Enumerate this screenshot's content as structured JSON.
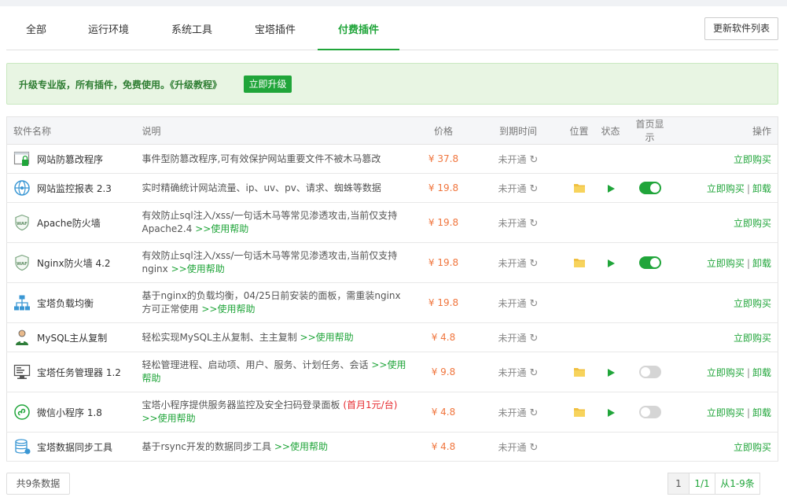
{
  "tabs": [
    "全部",
    "运行环境",
    "系统工具",
    "宝塔插件",
    "付费插件"
  ],
  "active_tab": "付费插件",
  "refresh_button": "更新软件列表",
  "upgrade": {
    "text": "升级专业版，所有插件，免费使用。《升级教程》",
    "button": "立即升级"
  },
  "columns": {
    "name": "软件名称",
    "desc": "说明",
    "price": "价格",
    "expire": "到期时间",
    "position": "位置",
    "state": "状态",
    "home": "首页显示",
    "op": "操作"
  },
  "rows": [
    {
      "name": "网站防篡改程序",
      "icon": "window-lock-icon",
      "desc": "事件型防篡改程序,可有效保护网站重要文件不被木马篡改",
      "help": "",
      "promo": "",
      "price": "¥ 37.8",
      "expire": "未开通",
      "installed": false,
      "toggle": null,
      "buy": "立即购买",
      "uninstall": ""
    },
    {
      "name": "网站监控报表 2.3",
      "icon": "globe-icon",
      "desc": "实时精确统计网站流量、ip、uv、pv、请求、蜘蛛等数据",
      "help": "",
      "promo": "",
      "price": "¥ 19.8",
      "expire": "未开通",
      "installed": true,
      "toggle": true,
      "buy": "立即购买",
      "uninstall": "卸载"
    },
    {
      "name": "Apache防火墙",
      "icon": "waf-shield-icon",
      "desc": "有效防止sql注入/xss/一句话木马等常见渗透攻击,当前仅支持Apache2.4",
      "help": ">>使用帮助",
      "promo": "",
      "price": "¥ 19.8",
      "expire": "未开通",
      "installed": false,
      "toggle": null,
      "buy": "立即购买",
      "uninstall": ""
    },
    {
      "name": "Nginx防火墙 4.2",
      "icon": "waf-shield-icon",
      "desc": "有效防止sql注入/xss/一句话木马等常见渗透攻击,当前仅支持nginx",
      "help": ">>使用帮助",
      "promo": "",
      "price": "¥ 19.8",
      "expire": "未开通",
      "installed": true,
      "toggle": true,
      "buy": "立即购买",
      "uninstall": "卸载"
    },
    {
      "name": "宝塔负载均衡",
      "icon": "network-icon",
      "desc": "基于nginx的负载均衡，04/25日前安装的面板，需重装nginx方可正常使用",
      "help": ">>使用帮助",
      "promo": "",
      "price": "¥ 19.8",
      "expire": "未开通",
      "installed": false,
      "toggle": null,
      "buy": "立即购买",
      "uninstall": ""
    },
    {
      "name": "MySQL主从复制",
      "icon": "database-user-icon",
      "desc": "轻松实现MySQL主从复制、主主复制",
      "help": ">>使用帮助",
      "promo": "",
      "price": "¥ 4.8",
      "expire": "未开通",
      "installed": false,
      "toggle": null,
      "buy": "立即购买",
      "uninstall": ""
    },
    {
      "name": "宝塔任务管理器 1.2",
      "icon": "monitor-icon",
      "desc": "轻松管理进程、启动项、用户、服务、计划任务、会话",
      "help": ">>使用帮助",
      "promo": "",
      "price": "¥ 9.8",
      "expire": "未开通",
      "installed": true,
      "toggle": false,
      "buy": "立即购买",
      "uninstall": "卸载"
    },
    {
      "name": "微信小程序 1.8",
      "icon": "wechat-app-icon",
      "desc": "宝塔小程序提供服务器监控及安全扫码登录面板",
      "help": ">>使用帮助",
      "promo": "(首月1元/台)",
      "price": "¥ 4.8",
      "expire": "未开通",
      "installed": true,
      "toggle": false,
      "buy": "立即购买",
      "uninstall": "卸载"
    },
    {
      "name": "宝塔数据同步工具",
      "icon": "database-sync-icon",
      "desc": "基于rsync开发的数据同步工具",
      "help": ">>使用帮助",
      "promo": "",
      "price": "¥ 4.8",
      "expire": "未开通",
      "installed": false,
      "toggle": null,
      "buy": "立即购买",
      "uninstall": ""
    }
  ],
  "row_heights": [
    37,
    37,
    51,
    51,
    51,
    37,
    51,
    51,
    37
  ],
  "footer": {
    "count": "共9条数据"
  },
  "pager": {
    "first": "1",
    "page": "1/1",
    "range": "从1-9条"
  },
  "colors": {
    "accent": "#20a53a",
    "price": "#f0753d",
    "promo": "#e6292e"
  }
}
